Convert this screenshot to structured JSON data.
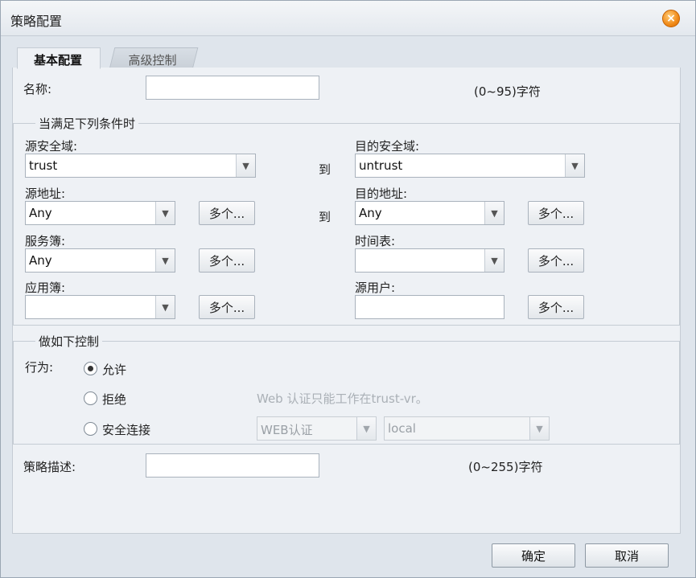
{
  "dialog": {
    "title": "策略配置",
    "close_label": "×"
  },
  "tabs": [
    {
      "label": "基本配置",
      "active": true
    },
    {
      "label": "高级控制",
      "active": false
    }
  ],
  "name_field": {
    "label": "名称:",
    "value": "",
    "hint": "(0~95)字符"
  },
  "conditions": {
    "legend": "当满足下列条件时",
    "to_label": "到",
    "multi_label": "多个...",
    "src_zone": {
      "label": "源安全域:",
      "value": "trust"
    },
    "dst_zone": {
      "label": "目的安全域:",
      "value": "untrust"
    },
    "src_addr": {
      "label": "源地址:",
      "value": "Any"
    },
    "dst_addr": {
      "label": "目的地址:",
      "value": "Any"
    },
    "service": {
      "label": "服务簿:",
      "value": "Any"
    },
    "schedule": {
      "label": "时间表:",
      "value": ""
    },
    "application": {
      "label": "应用簿:",
      "value": ""
    },
    "src_user": {
      "label": "源用户:",
      "value": ""
    }
  },
  "control": {
    "legend": "做如下控制",
    "action_label": "行为:",
    "options": [
      {
        "label": "允许",
        "checked": true
      },
      {
        "label": "拒绝",
        "checked": false
      },
      {
        "label": "安全连接",
        "checked": false
      }
    ],
    "web_auth_note": "Web 认证只能工作在trust-vr。",
    "auth_type": "WEB认证",
    "auth_server": "local"
  },
  "description": {
    "label": "策略描述:",
    "value": "",
    "hint": "(0~255)字符"
  },
  "footer": {
    "ok_label": "确定",
    "cancel_label": "取消"
  }
}
